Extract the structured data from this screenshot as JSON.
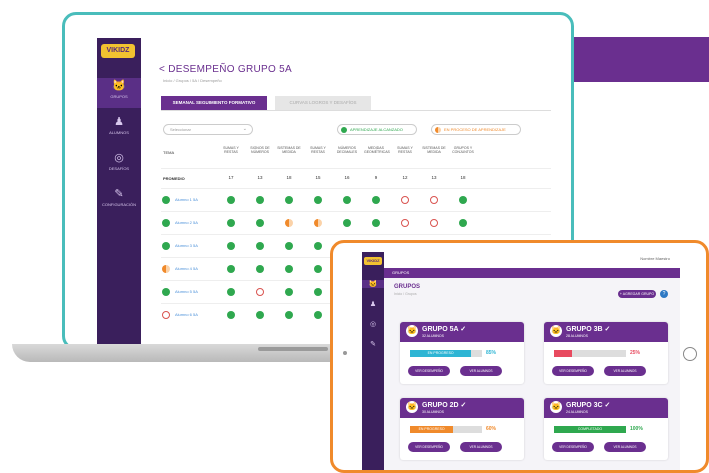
{
  "laptop": {
    "logo": "VIKIDZ",
    "sidebar": [
      {
        "icon": "cat-icon",
        "glyph": "🐱",
        "label": "GRUPOS"
      },
      {
        "icon": "people-icon",
        "glyph": "♟",
        "label": "ALUMNOS"
      },
      {
        "icon": "target-icon",
        "glyph": "◎",
        "label": "DESAFÍOS"
      },
      {
        "icon": "report-icon",
        "glyph": "✎",
        "label": "CONFIGURACIÓN"
      }
    ],
    "title": "< DESEMPEÑO GRUPO 5A",
    "subtitle": "Inicio / Grupos / 5A / Desempeño",
    "tabs": {
      "active": "SEMANAL SEGUIMIENTO FORMATIVO",
      "inactive": "CURVAS LOGROS Y DESAFÍOS"
    },
    "select_placeholder": "Seleccionar",
    "legend": {
      "green": "APRENDIZAJE ALCANZADO",
      "orange": "EN PROCESO DE APRENDIZAJE"
    },
    "header_first": "TEMA",
    "columns": [
      "SUMAS Y RESTAS",
      "SIGNOS DE NÚMEROS",
      "SISTEMAS DE MEDIDA",
      "SUMAS Y RESTAS",
      "NÚMEROS DECIMALES",
      "MEDIDAS GEOMÉTRICAS",
      "SUMAS Y RESTAS",
      "SISTEMAS DE MEDIDA",
      "GRUPOS Y CONJUNTOS"
    ],
    "totals_label": "PROMEDIO",
    "totals": [
      "17",
      "13",
      "18",
      "15",
      "16",
      "9",
      "12",
      "13",
      "18"
    ],
    "rows": [
      {
        "name": "Alumno 1 5A",
        "status": "g",
        "cells": [
          "g",
          "g",
          "g",
          "g",
          "g",
          "g",
          "e",
          "e",
          "g"
        ]
      },
      {
        "name": "Alumno 2 5A",
        "status": "g",
        "cells": [
          "g",
          "g",
          "o",
          "o",
          "g",
          "g",
          "e",
          "e",
          "g"
        ]
      },
      {
        "name": "Alumno 3 5A",
        "status": "g",
        "cells": [
          "g",
          "g",
          "g",
          "g",
          "g",
          "g",
          "g",
          "g",
          "g"
        ]
      },
      {
        "name": "Alumno 4 5A",
        "status": "o",
        "cells": [
          "g",
          "g",
          "g",
          "g",
          "g",
          "g",
          "g",
          "g",
          "g"
        ]
      },
      {
        "name": "Alumno 5 5A",
        "status": "g",
        "cells": [
          "g",
          "e",
          "g",
          "g",
          "g",
          "g",
          "g",
          "g",
          "g"
        ]
      },
      {
        "name": "Alumno 6 5A",
        "status": "e",
        "cells": [
          "g",
          "g",
          "g",
          "g",
          "g",
          "g",
          "g",
          "g",
          "g"
        ]
      }
    ]
  },
  "tablet": {
    "logo": "VIKIDZ",
    "user": "Nombre Maestro",
    "bar_label": "GRUPOS",
    "title": "GRUPOS",
    "subtitle": "Inicio / Grupos",
    "add_button": "+ AGREGAR GRUPO",
    "help": "?",
    "cards": [
      {
        "name": "GRUPO 5A",
        "count": "32 ALUMNOS",
        "progress": 0.85,
        "bar_label": "EN PROGRESO",
        "percent": "85%",
        "color": "#2eb5d4",
        "btn1": "VER DESEMPEÑO",
        "btn2": "VER ALUMNOS"
      },
      {
        "name": "GRUPO 3B",
        "count": "28 ALUMNOS",
        "progress": 0.25,
        "bar_label": "",
        "percent": "25%",
        "color": "#e84a5f",
        "btn1": "VER DESEMPEÑO",
        "btn2": "VER ALUMNOS"
      },
      {
        "name": "GRUPO 2D",
        "count": "30 ALUMNOS",
        "progress": 0.6,
        "bar_label": "EN PROGRESO",
        "percent": "60%",
        "color": "#f08a2b",
        "btn1": "VER DESEMPEÑO",
        "btn2": "VER ALUMNOS"
      },
      {
        "name": "GRUPO 3C",
        "count": "24 ALUMNOS",
        "progress": 1.0,
        "bar_label": "COMPLETADO",
        "percent": "100%",
        "color": "#2fa84f",
        "btn1": "VER DESEMPEÑO",
        "btn2": "VER ALUMNOS"
      }
    ]
  }
}
